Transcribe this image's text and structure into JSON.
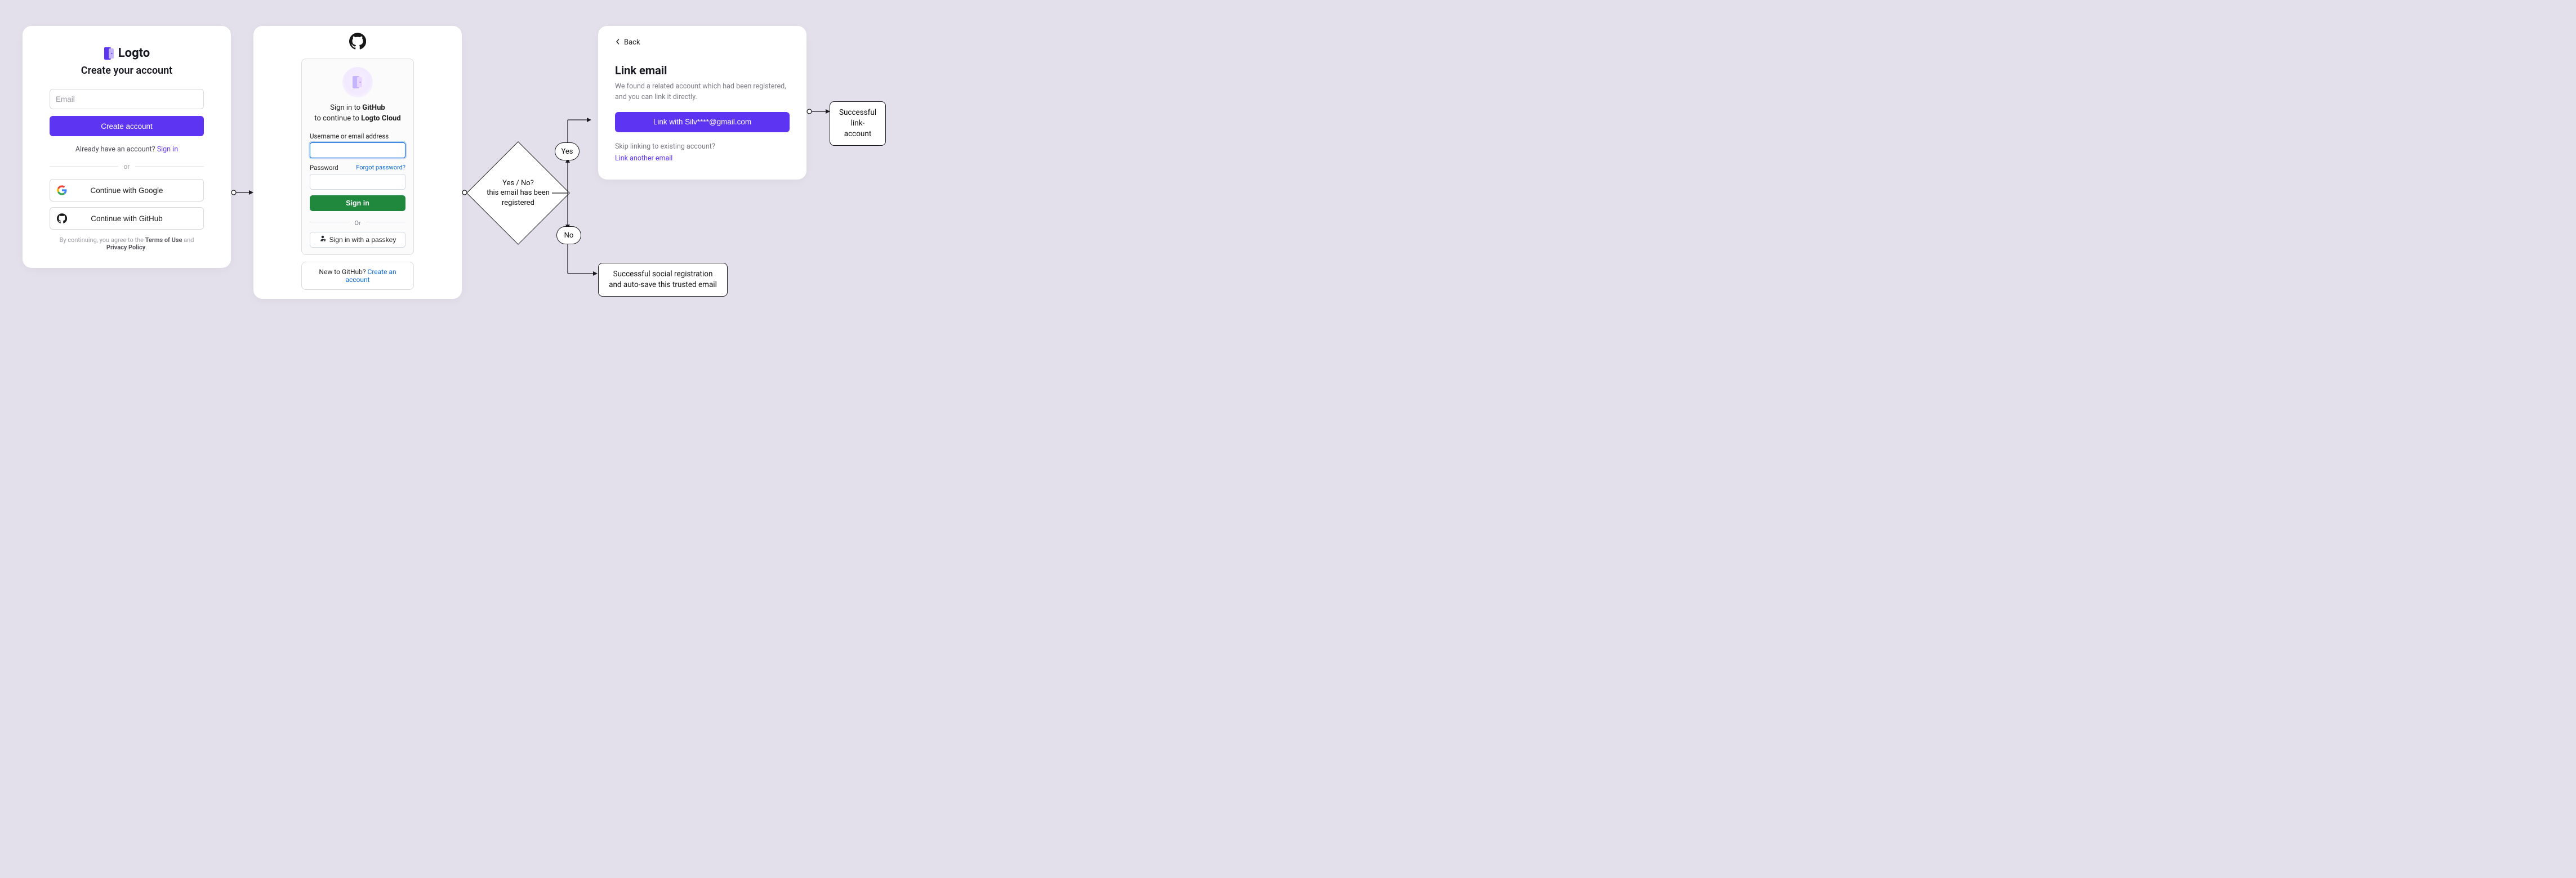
{
  "logto_card": {
    "brand": "Logto",
    "heading": "Create your account",
    "email_placeholder": "Email",
    "create_button": "Create account",
    "have_account_prefix": "Already have an account? ",
    "signin_link": "Sign in",
    "or": "or",
    "google_button": "Continue with Google",
    "github_button": "Continue with GitHub",
    "terms_prefix": "By continuing, you agree to the ",
    "terms_of_use": "Terms of Use",
    "terms_and": " and ",
    "privacy_policy": "Privacy Policy",
    "terms_suffix": "."
  },
  "github_card": {
    "signin_prefix": "Sign in to ",
    "signin_target": "GitHub",
    "continue_prefix": "to continue to ",
    "continue_target": "Logto Cloud",
    "username_label": "Username or email address",
    "password_label": "Password",
    "forgot": "Forgot password?",
    "signin_button": "Sign in",
    "or": "Or",
    "passkey_button": "Sign in with a passkey",
    "new_prefix": "New to GitHub? ",
    "new_link": "Create an account"
  },
  "decision": {
    "question_line1": "Yes / No?",
    "question_line2": "this email has been registered",
    "yes": "Yes",
    "no": "No"
  },
  "outcomes": {
    "social_registration": "Successful social registration and auto-save this trusted email",
    "link_account": "Successful link-account"
  },
  "link_card": {
    "back": "Back",
    "heading": "Link email",
    "lead": "We found a related account which had been registered, and you can link it directly.",
    "link_button": "Link with Silv****@gmail.com",
    "skip_question": "Skip linking to existing account?",
    "link_another": "Link another email"
  }
}
